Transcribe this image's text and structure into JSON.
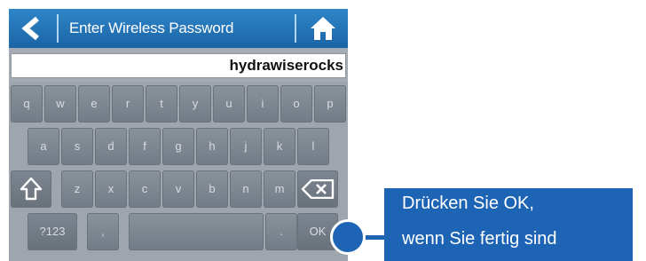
{
  "header": {
    "title": "Enter Wireless Password",
    "back_icon": "chevron-left-icon",
    "home_icon": "home-icon"
  },
  "password_field": {
    "value": "hydrawiserocks"
  },
  "keyboard": {
    "row1": [
      "q",
      "w",
      "e",
      "r",
      "t",
      "y",
      "u",
      "i",
      "o",
      "p"
    ],
    "row2": [
      "a",
      "s",
      "d",
      "f",
      "g",
      "h",
      "j",
      "k",
      "l"
    ],
    "row3": [
      "z",
      "x",
      "c",
      "v",
      "b",
      "n",
      "m"
    ],
    "shift_icon": "shift-icon",
    "backspace_icon": "backspace-icon",
    "mode_label": "?123",
    "comma_label": ",",
    "period_label": ".",
    "ok_label": "OK"
  },
  "callout": {
    "line1": "Drücken Sie OK,",
    "line2": "wenn Sie fertig sind"
  },
  "colors": {
    "header_blue": "#1a64a6",
    "callout_blue": "#1e64b4",
    "keyboard_bg": "#9ea5ae"
  }
}
